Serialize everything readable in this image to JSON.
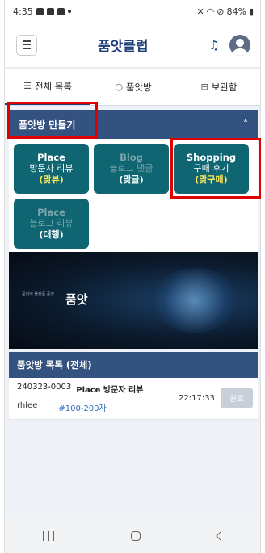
{
  "status_bar": {
    "time": "4:35",
    "battery": "84%"
  },
  "header": {
    "title": "품앗클럽"
  },
  "tabs": [
    {
      "icon": "list-icon",
      "label": "전체 목록",
      "active": true
    },
    {
      "icon": "chat-icon",
      "label": "품앗방",
      "active": false
    },
    {
      "icon": "archive-icon",
      "label": "보관함",
      "active": false
    }
  ],
  "create_section": {
    "title": "품앗방 만들기",
    "collapse_glyph": "˄",
    "cards": [
      {
        "line1": "Place",
        "line2": "방문자 리뷰",
        "line3": "(맞뷰)",
        "enabled": true
      },
      {
        "line1": "Blog",
        "line2": "블로그 댓글",
        "line3": "(맞글)",
        "enabled": false
      },
      {
        "line1": "Shopping",
        "line2": "구매 후기",
        "line3": "(맞구매)",
        "enabled": true
      },
      {
        "line1": "Place",
        "line2": "블로그 리뷰",
        "line3": "(대행)",
        "enabled": false
      }
    ]
  },
  "banner": {
    "brand": "품앗",
    "tagline": "품앗이 플랫폼 품앗"
  },
  "list_section": {
    "title": "품앗방 목록 (전체)",
    "items": [
      {
        "id": "240323-0003",
        "category": "Place 방문자 리뷰",
        "user": "rhlee",
        "range": "#100-200자",
        "time": "22:17:33",
        "status": "완료"
      }
    ]
  },
  "colors": {
    "primary": "#34527f",
    "card": "#0f6672",
    "highlight": "#ffe75a",
    "annotation": "#e00000"
  }
}
